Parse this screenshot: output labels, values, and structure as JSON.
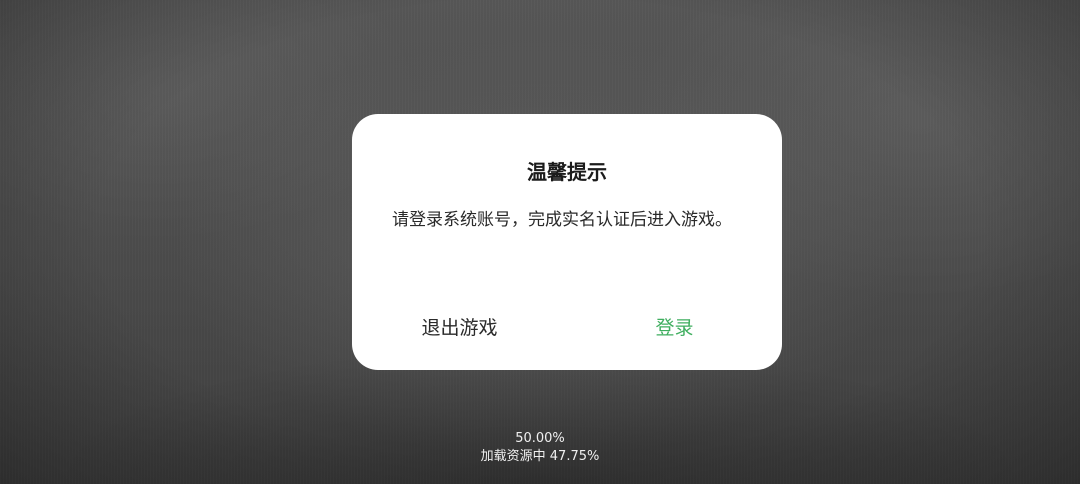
{
  "dialog": {
    "title": "温馨提示",
    "message": "请登录系统账号，完成实名认证后进入游戏。",
    "exit_label": "退出游戏",
    "login_label": "登录"
  },
  "loading": {
    "progress_text": "50.00%",
    "status_text": "加载资源中 47.75%",
    "progress_value": 50.0,
    "resource_progress_value": 47.75
  },
  "colors": {
    "accent": "#3fae5f",
    "dialog_background": "#ffffff"
  }
}
